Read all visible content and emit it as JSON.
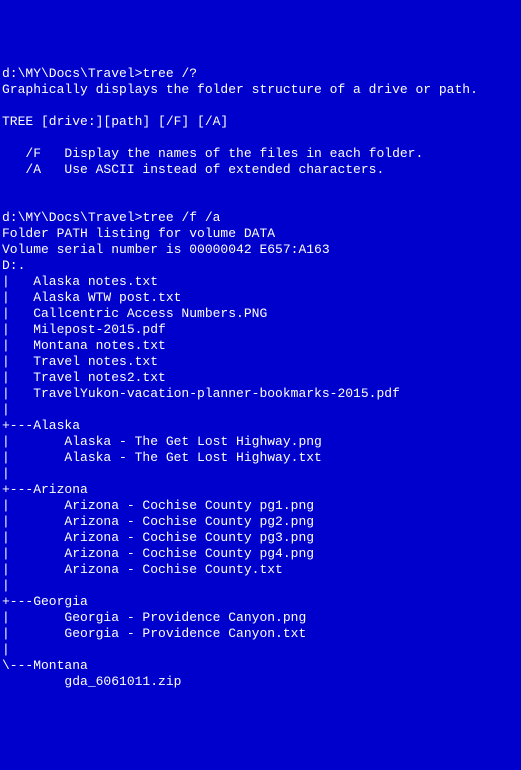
{
  "terminal": {
    "prompt1": "d:\\MY\\Docs\\Travel>",
    "cmd1": "tree /?",
    "help_desc": "Graphically displays the folder structure of a drive or path.",
    "help_usage": "TREE [drive:][path] [/F] [/A]",
    "help_f": "   /F   Display the names of the files in each folder.",
    "help_a": "   /A   Use ASCII instead of extended characters.",
    "prompt2": "d:\\MY\\Docs\\Travel>",
    "cmd2": "tree /f /a",
    "vol_line": "Folder PATH listing for volume DATA",
    "serial_line": "Volume serial number is 00000042 E657:A163",
    "root": "D:.",
    "files": [
      "|   Alaska notes.txt",
      "|   Alaska WTW post.txt",
      "|   Callcentric Access Numbers.PNG",
      "|   Milepost-2015.pdf",
      "|   Montana notes.txt",
      "|   Travel notes.txt",
      "|   Travel notes2.txt",
      "|   TravelYukon-vacation-planner-bookmarks-2015.pdf",
      "|",
      "+---Alaska",
      "|       Alaska - The Get Lost Highway.png",
      "|       Alaska - The Get Lost Highway.txt",
      "|",
      "+---Arizona",
      "|       Arizona - Cochise County pg1.png",
      "|       Arizona - Cochise County pg2.png",
      "|       Arizona - Cochise County pg3.png",
      "|       Arizona - Cochise County pg4.png",
      "|       Arizona - Cochise County.txt",
      "|",
      "+---Georgia",
      "|       Georgia - Providence Canyon.png",
      "|       Georgia - Providence Canyon.txt",
      "|",
      "\\---Montana",
      "        gda_6061011.zip"
    ]
  }
}
